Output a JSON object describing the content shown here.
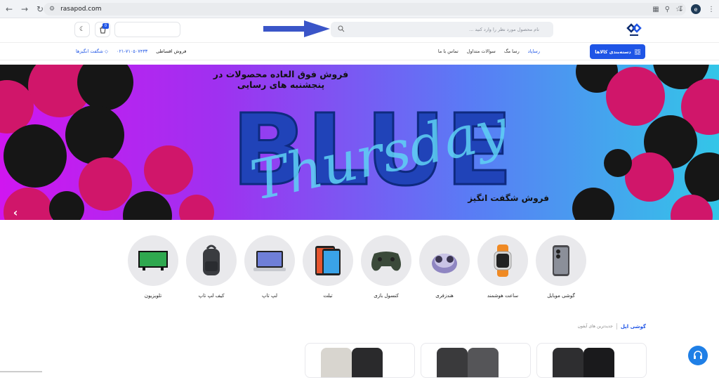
{
  "browser": {
    "url": "rasapod.com",
    "profile_initial": "e"
  },
  "header": {
    "search_placeholder": "نام محصول مورد نظر را وارد کنید ...",
    "cart_count": "0"
  },
  "nav": {
    "category_button": "دسته‌بندی کالاها",
    "links": [
      "رساپاد",
      "رسا مگ",
      "سوالات متداول",
      "تماس با ما"
    ],
    "installment": "فروش اقساطی",
    "phone": "۰۲۱-۷۱۰۵۰۷۴۳۳",
    "amazing": "شگفت انگیزها"
  },
  "banner": {
    "title": "فروش فوق العاده محصولات در پنجشنبه های رسایی",
    "big_text": "BLUE",
    "script_text": "Thursday",
    "subtitle": "فروش شگفت انگیز"
  },
  "categories": [
    {
      "label": "گوشی موبایل",
      "icon": "phone-icon"
    },
    {
      "label": "ساعت هوشمند",
      "icon": "smartwatch-icon"
    },
    {
      "label": "هندزفری",
      "icon": "earbuds-icon"
    },
    {
      "label": "کنسول بازی",
      "icon": "gamepad-icon"
    },
    {
      "label": "تبلت",
      "icon": "tablet-icon"
    },
    {
      "label": "لپ تاپ",
      "icon": "laptop-icon"
    },
    {
      "label": "کیف لپ تاپ",
      "icon": "backpack-icon"
    },
    {
      "label": "تلویزیون",
      "icon": "tv-icon"
    }
  ],
  "section": {
    "title": "گوشی اپل",
    "subtitle": "جدیدترین های آیفون"
  },
  "colors": {
    "accent": "#1f55e6",
    "banner_pink": "#d0166a",
    "banner_dark": "#1a1a1a"
  }
}
